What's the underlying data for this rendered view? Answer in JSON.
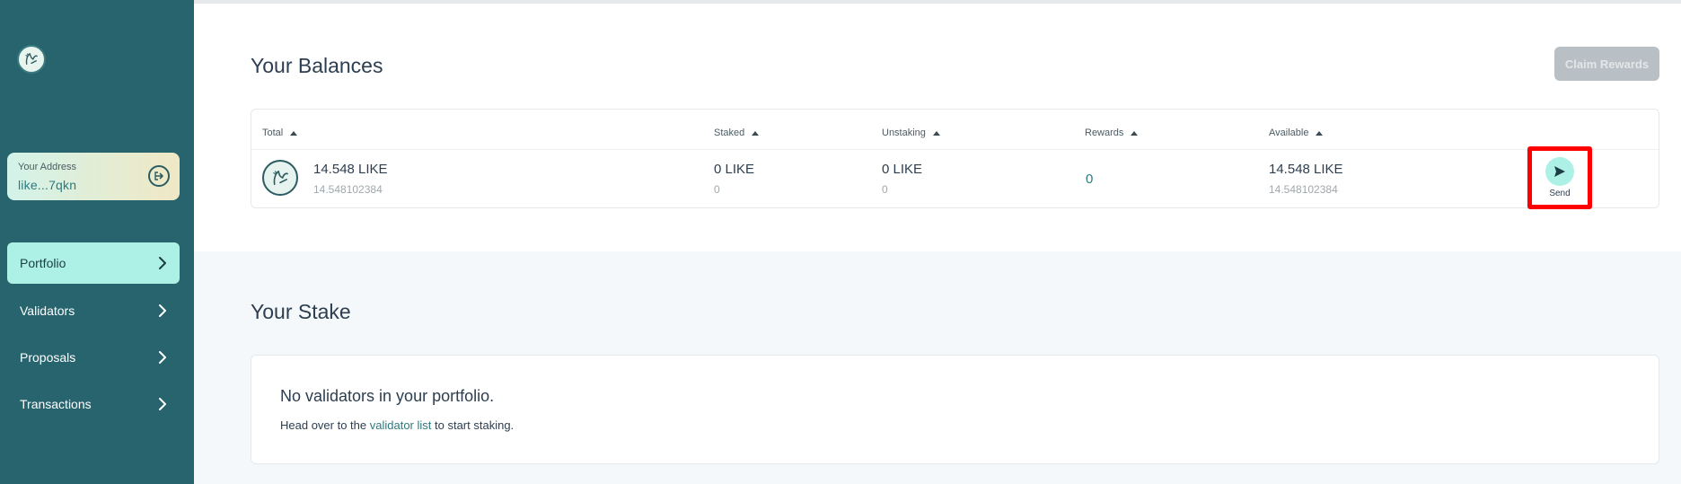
{
  "sidebar": {
    "address_label": "Your Address",
    "address_value": "like...7qkn",
    "nav": [
      {
        "label": "Portfolio",
        "active": true
      },
      {
        "label": "Validators",
        "active": false
      },
      {
        "label": "Proposals",
        "active": false
      },
      {
        "label": "Transactions",
        "active": false
      }
    ]
  },
  "balances": {
    "title": "Your Balances",
    "claim_label": "Claim Rewards",
    "columns": [
      "Total",
      "Staked",
      "Unstaking",
      "Rewards",
      "Available"
    ],
    "row": {
      "total": "14.548 LIKE",
      "total_sub": "14.548102384",
      "staked": "0 LIKE",
      "staked_sub": "0",
      "unstaking": "0 LIKE",
      "unstaking_sub": "0",
      "rewards": "0",
      "available": "14.548 LIKE",
      "available_sub": "14.548102384",
      "send_label": "Send"
    }
  },
  "stake": {
    "title": "Your Stake",
    "empty_title": "No validators in your portfolio.",
    "empty_prefix": "Head over to the",
    "empty_link": "validator list",
    "empty_suffix": "to start staking."
  },
  "colors": {
    "sidebar": "#28646e",
    "accent": "#adf1e6",
    "highlight": "#ff0000"
  }
}
